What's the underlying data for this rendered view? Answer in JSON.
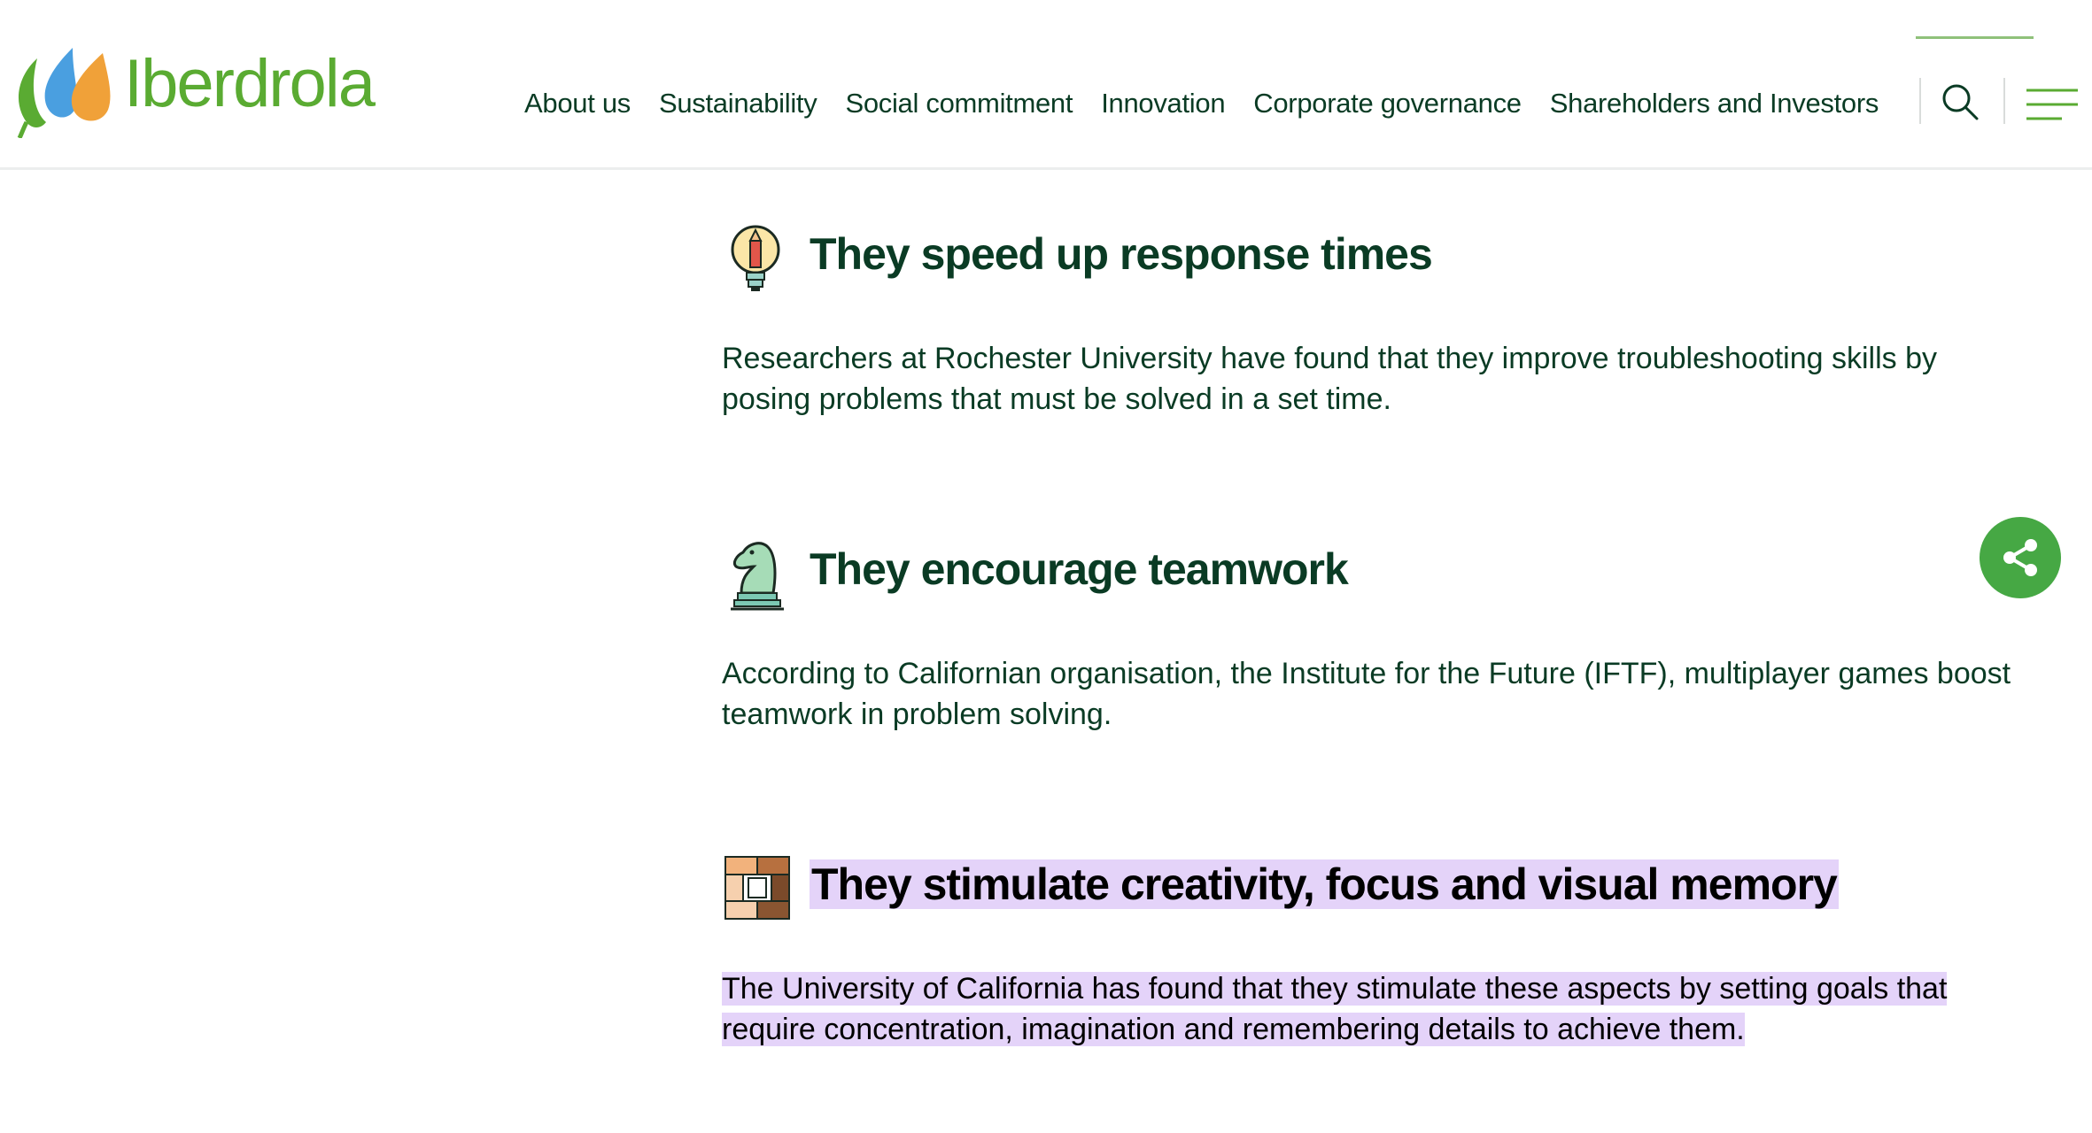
{
  "brand": {
    "name": "Iberdrola",
    "color": "#5aab32"
  },
  "nav": {
    "items": [
      {
        "label": "About us"
      },
      {
        "label": "Sustainability"
      },
      {
        "label": "Social commitment"
      },
      {
        "label": "Innovation"
      },
      {
        "label": "Corporate governance"
      },
      {
        "label": "Shareholders and Investors"
      }
    ],
    "search_icon": "search-icon",
    "menu_icon": "hamburger-menu-icon"
  },
  "sections": [
    {
      "icon": "lightbulb-icon",
      "title": "They speed up response times",
      "text": "Researchers at Rochester University have found that they improve troubleshooting skills by posing problems that must be solved in a set time.",
      "highlighted": false
    },
    {
      "icon": "chess-knight-icon",
      "title": "They encourage teamwork",
      "text": "According to Californian organisation, the Institute for the Future (IFTF), multiplayer games boost teamwork in problem solving.",
      "highlighted": false
    },
    {
      "icon": "joined-hands-icon",
      "title": "They stimulate creativity, focus and visual memory",
      "text": "The University of California has found that they stimulate these aspects by setting goals that require concentration, imagination and remembering details to achieve them.",
      "highlighted": true
    }
  ],
  "share": {
    "icon": "share-icon",
    "color": "#46a844"
  },
  "colors": {
    "text_dark_green": "#0a3b24",
    "highlight": "#e4d3f9"
  }
}
